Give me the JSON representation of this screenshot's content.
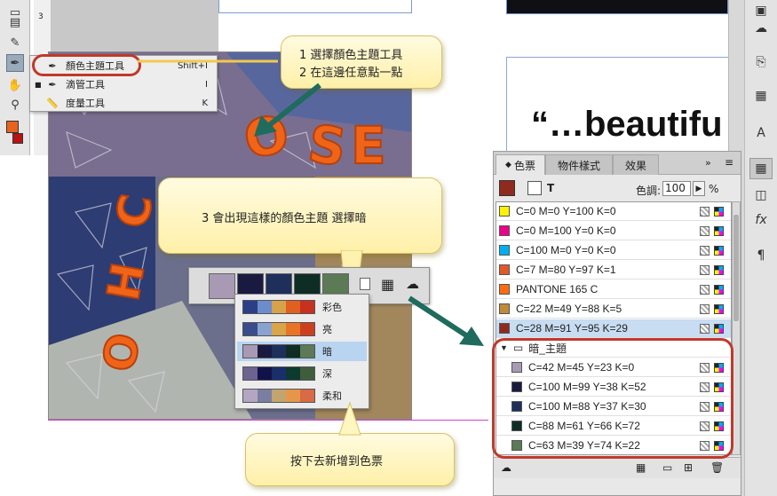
{
  "flyout": {
    "items": [
      {
        "label": "顏色主題工具",
        "shortcut": "Shift+I"
      },
      {
        "label": "滴管工具",
        "shortcut": "I"
      },
      {
        "label": "度量工具",
        "shortcut": "K"
      }
    ]
  },
  "ruler": {
    "mark": "3"
  },
  "document": {
    "heading": "“…beautifu"
  },
  "callouts": {
    "step12_line1": "1 選擇顏色主題工具",
    "step12_line2": "2 在這邊任意點一點",
    "step3": "3 會出現這樣的顏色主題 選擇暗",
    "add": "按下去新增到色票"
  },
  "color_theme": {
    "swatches": [
      "#a89ab4",
      "#1a1a40",
      "#1f2f5c",
      "#0e2d25",
      "#5b7a55"
    ],
    "options": [
      {
        "name": "彩色",
        "colors": [
          "#2b3f88",
          "#6d8ccb",
          "#d6a24a",
          "#e06020",
          "#c83020"
        ]
      },
      {
        "name": "亮",
        "colors": [
          "#3a4d8a",
          "#8aa2d0",
          "#d9a548",
          "#e87424",
          "#cc4020"
        ]
      },
      {
        "name": "暗",
        "colors": [
          "#a89ab4",
          "#1a1a40",
          "#1f2f5c",
          "#0e2d25",
          "#5b7a55"
        ]
      },
      {
        "name": "深",
        "colors": [
          "#6c6390",
          "#12124a",
          "#1a2e6a",
          "#0c3a2e",
          "#3f5d3c"
        ]
      },
      {
        "name": "柔和",
        "colors": [
          "#b4a6c2",
          "#7a7ea2",
          "#c2a56e",
          "#e6964a",
          "#d86a44"
        ]
      }
    ],
    "selected": "暗"
  },
  "swatches_panel": {
    "tabs": [
      "色票",
      "物件樣式",
      "效果"
    ],
    "tint_label": "色調:",
    "tint_value": "100",
    "tint_unit": "%",
    "rows": [
      {
        "label": "C=0 M=0 Y=100 K=0",
        "color": "#fff200"
      },
      {
        "label": "C=0 M=100 Y=0 K=0",
        "color": "#ec008c"
      },
      {
        "label": "C=100 M=0 Y=0 K=0",
        "color": "#00aeef"
      },
      {
        "label": "C=7 M=80 Y=97 K=1",
        "color": "#e0572a"
      },
      {
        "label": "PANTONE 165 C",
        "color": "#ff6a13"
      },
      {
        "label": "C=22 M=49 Y=88 K=5",
        "color": "#c08a3a"
      },
      {
        "label": "C=28 M=91 Y=95 K=29",
        "color": "#8f2a1f"
      }
    ],
    "group_name": "暗_主題",
    "group_rows": [
      {
        "label": "C=42 M=45 Y=23 K=0",
        "color": "#a89ab4"
      },
      {
        "label": "C=100 M=99 Y=38 K=52",
        "color": "#1a1a40"
      },
      {
        "label": "C=100 M=88 Y=37 K=30",
        "color": "#1f2f5c"
      },
      {
        "label": "C=88 M=61 Y=66 K=72",
        "color": "#0e2d25"
      },
      {
        "label": "C=63 M=39 Y=74 K=22",
        "color": "#5b7a55"
      }
    ]
  },
  "accent": {
    "highlight": "#c0392b",
    "arrow": "#1f6b5e"
  }
}
